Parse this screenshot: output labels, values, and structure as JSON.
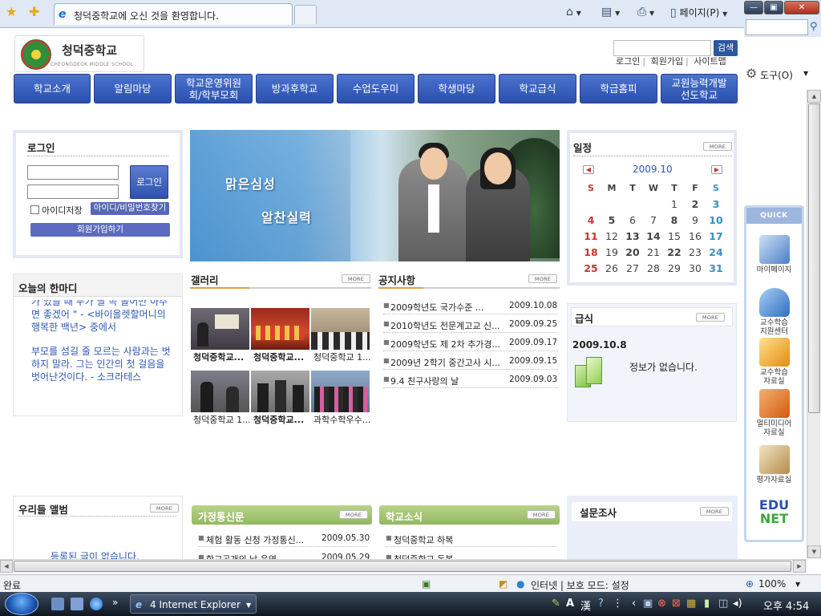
{
  "browser": {
    "tab_title": "청덕중학교에 오신 것을 환영합니다.",
    "page_menu": "페이지(P)",
    "tools_menu": "도구(O)",
    "status_text": "완료",
    "zone_text": "인터넷 | 보호 모드: 설정",
    "zoom": "100%",
    "taskbar_ie": "4 Internet Explorer",
    "clock": "오후 4:54"
  },
  "site": {
    "school_name": "청덕중학교",
    "school_name_en": "CHEONGDEOK MIDDLE SCHOOL",
    "search_button": "검색",
    "util_links": [
      "로그인",
      "회원가입",
      "사이트맵"
    ],
    "nav": [
      "학교소개",
      "알림마당",
      "학교운영위원\n회/학부모회",
      "방과후학교",
      "수업도우미",
      "학생마당",
      "학교급식",
      "학급홈피",
      "교원능력개발\n선도학교"
    ]
  },
  "login": {
    "title": "로그인",
    "login_button": "로그인",
    "save_id": "아이디저장",
    "find_button": "아이디/비밀번호찾기",
    "join_button": "회원가입하기"
  },
  "quote": {
    "title": "오늘의 한마디",
    "text_1": "가 있을 때 누가 딸 쪽 놀어만 아주면 좋겠어 \" - <바이올렛할머니의 행복한 백년> 중에서",
    "text_2": "부모를 섬길 줄 모르는 사람과는 벗하지 말라. 그는 인간의 첫 걸음을 벗어난것이다. - 소크라테스"
  },
  "banner": {
    "line1": "맑은심성",
    "line2": "알찬실력"
  },
  "gallery": {
    "title": "갤러리",
    "more": "MORE",
    "items": [
      {
        "caption": "청덕중학교...",
        "color": "#b5651d"
      },
      {
        "caption": "청덕중학교...",
        "color": "#b5651d"
      },
      {
        "caption": "청덕중학교 1...",
        "color": "#c98a2e"
      },
      {
        "caption": "청덕중학교 1...",
        "color": "#b5651d"
      },
      {
        "caption": "청덕중학교...",
        "color": "#b5651d"
      },
      {
        "caption": "과학수학우수...",
        "color": "#333333"
      }
    ]
  },
  "notices": {
    "title": "공지사항",
    "more": "MORE",
    "rows": [
      {
        "title": "2009학년도 국가수준 ...",
        "date": "2009.10.08"
      },
      {
        "title": "2010학년도 전문계고교 신...",
        "date": "2009.09.25"
      },
      {
        "title": "2009학년도 제 2차 추가경...",
        "date": "2009.09.17"
      },
      {
        "title": "2009년 2학기 중간고사 시...",
        "date": "2009.09.15"
      },
      {
        "title": "9.4 친구사랑의 날",
        "date": "2009.09.03"
      }
    ]
  },
  "schedule": {
    "title": "일정",
    "more": "MORE",
    "month": "2009.10",
    "weekdays": [
      "S",
      "M",
      "T",
      "W",
      "T",
      "F",
      "S"
    ],
    "weeks": [
      [
        "",
        "",
        "",
        "",
        "1",
        "2",
        "3"
      ],
      [
        "4",
        "5",
        "6",
        "7",
        "8",
        "9",
        "10"
      ],
      [
        "11",
        "12",
        "13",
        "14",
        "15",
        "16",
        "17"
      ],
      [
        "18",
        "19",
        "20",
        "21",
        "22",
        "23",
        "24"
      ],
      [
        "25",
        "26",
        "27",
        "28",
        "29",
        "30",
        "31"
      ]
    ],
    "sunday_color": "#cc3333",
    "saturday_color": "#3a8fc0"
  },
  "meal": {
    "title": "급식",
    "more": "MORE",
    "date": "2009.10.8",
    "message": "정보가 없습니다."
  },
  "album": {
    "title": "우리들 앨범",
    "more": "MORE",
    "empty": "등록된 글이 없습니다."
  },
  "home_news": {
    "title": "가정통신문",
    "more": "MORE",
    "rows": [
      {
        "title": "체험 활동 신청 가정통신...",
        "date": "2009.05.30"
      },
      {
        "title": "학교공개의 날 운영",
        "date": "2009.05.29"
      }
    ]
  },
  "school_news": {
    "title": "학교소식",
    "more": "MORE",
    "rows": [
      {
        "title": "청덕중학교 하복",
        "date": ""
      },
      {
        "title": "청덕중학교 동복",
        "date": ""
      }
    ]
  },
  "survey": {
    "title": "설문조사",
    "more": "MORE"
  },
  "quick_menu": {
    "title": "QUICK MENU",
    "items": [
      "마이페이지",
      "교수학습\n지원센터",
      "교수학습\n자료실",
      "멀티미디어\n자료실",
      "평가자료실"
    ],
    "edunet_1": "EDU",
    "edunet_2": "NET"
  }
}
